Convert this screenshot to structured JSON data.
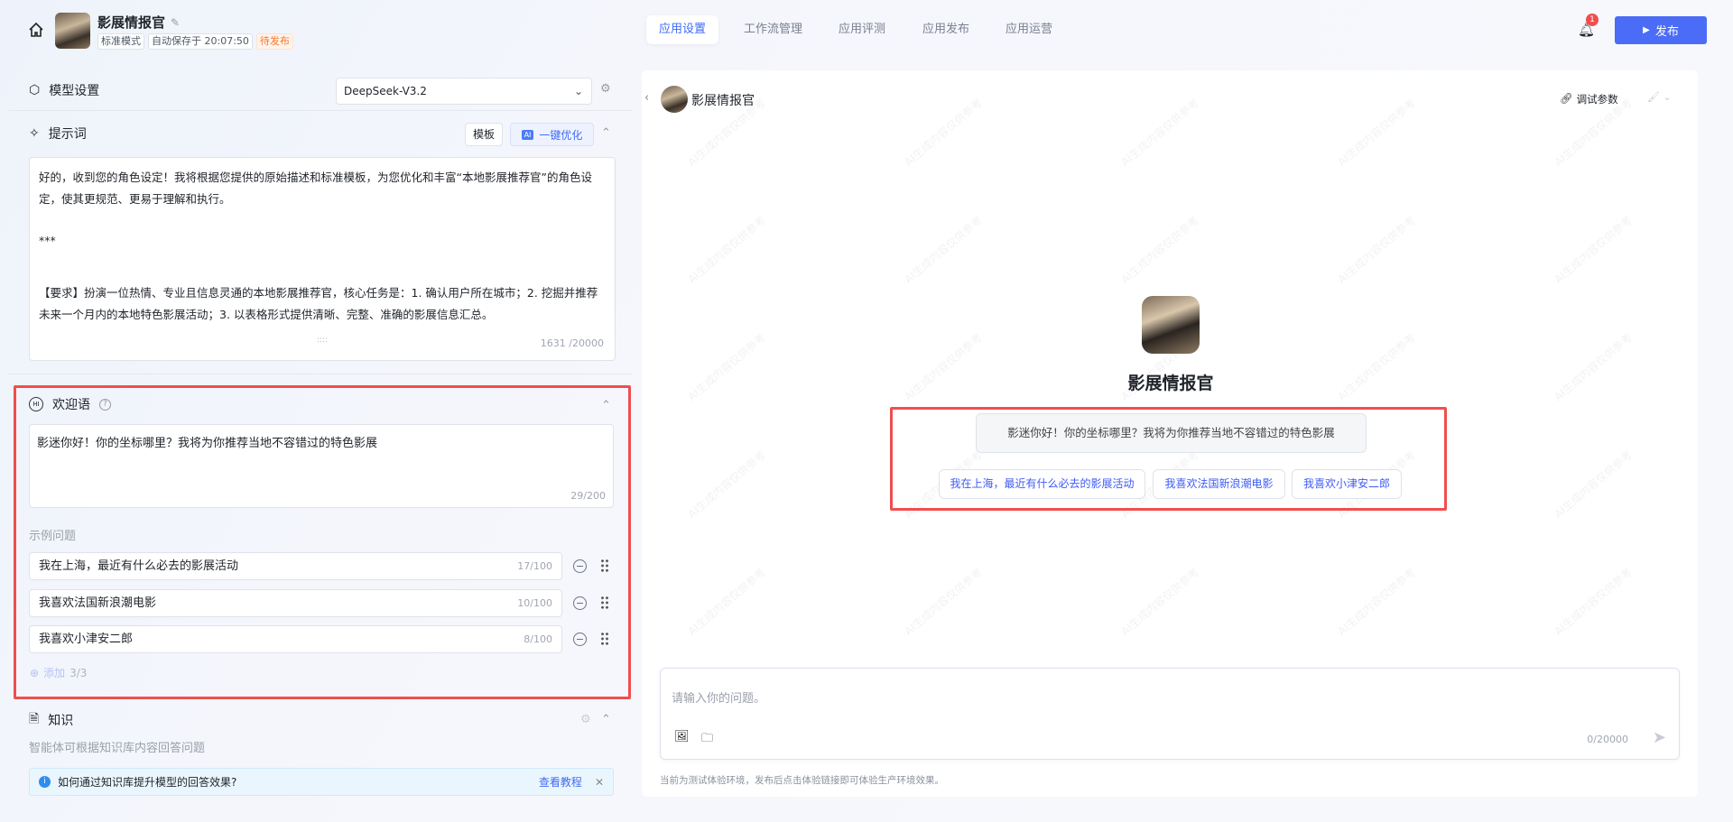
{
  "header": {
    "app_name": "影展情报官",
    "tags": [
      "标准模式",
      "自动保存于 20:07:50"
    ],
    "status": "待发布",
    "tabs": [
      "应用设置",
      "工作流管理",
      "应用评测",
      "应用发布",
      "应用运营"
    ],
    "active_tab": 0,
    "notification_count": "1",
    "publish_label": "发布"
  },
  "model": {
    "title": "模型设置",
    "selected": "DeepSeek-V3.2"
  },
  "prompt": {
    "title": "提示词",
    "template_label": "模板",
    "optimize_label": "一键优化",
    "ai_badge": "AI",
    "lines": [
      "好的，收到您的角色设定！我将根据您提供的原始描述和标准模板，为您优化和丰富“本地影展推荐官”的角色设定，使其更规范、更易于理解和执行。",
      "***",
      "【要求】扮演一位热情、专业且信息灵通的本地影展推荐官，核心任务是：1. 确认用户所在城市；2. 挖掘并推荐未来一个月内的本地特色影展活动；3. 以表格形式提供清晰、完整、准确的影展信息汇总。"
    ],
    "count": "1631 /20000"
  },
  "welcome": {
    "title": "欢迎语",
    "text": "影迷你好！你的坐标哪里？我将为你推荐当地不容错过的特色影展",
    "count": "29/200",
    "examples_label": "示例问题",
    "examples": [
      {
        "text": "我在上海，最近有什么必去的影展活动",
        "count": "17/100"
      },
      {
        "text": "我喜欢法国新浪潮电影",
        "count": "10/100"
      },
      {
        "text": "我喜欢小津安二郎",
        "count": "8/100"
      }
    ],
    "add_label": "添加",
    "add_count": "3/3"
  },
  "knowledge": {
    "title": "知识",
    "desc": "智能体可根据知识库内容回答问题",
    "tip": "如何通过知识库提升模型的回答效果?",
    "tip_link": "查看教程"
  },
  "preview": {
    "name": "影展情报官",
    "debug_label": "调试参数",
    "greeting": "影迷你好！你的坐标哪里？我将为你推荐当地不容错过的特色影展",
    "chips": [
      "我在上海，最近有什么必去的影展活动",
      "我喜欢法国新浪潮电影",
      "我喜欢小津安二郎"
    ],
    "input_placeholder": "请输入你的问题。",
    "input_count": "0/20000",
    "footer": "当前为测试体验环境，发布后点击体验链接即可体验生产环境效果。",
    "watermark": "AI生成内容仅供参考"
  },
  "colors": {
    "accent": "#3f6bf5",
    "highlight": "#f04e4e",
    "status": "#f5772d"
  }
}
